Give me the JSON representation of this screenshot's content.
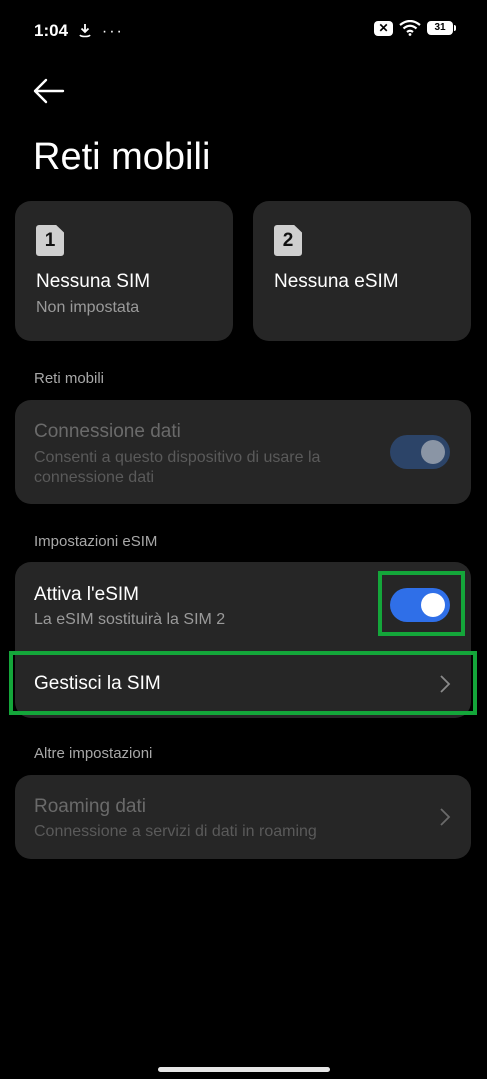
{
  "status_bar": {
    "time": "1:04",
    "left_icons": "⟟ ···",
    "sim_badge": "✕",
    "battery": "31"
  },
  "page": {
    "title": "Reti mobili"
  },
  "sims": [
    {
      "number": "1",
      "title": "Nessuna SIM",
      "subtitle": "Non impostata"
    },
    {
      "number": "2",
      "title": "Nessuna eSIM",
      "subtitle": ""
    }
  ],
  "sections": {
    "mobile_networks": "Reti mobili",
    "esim_settings": "Impostazioni eSIM",
    "other_settings": "Altre impostazioni"
  },
  "data_connection": {
    "title": "Connessione dati",
    "subtitle_line1": "Consenti a questo dispositivo di usare la",
    "subtitle_line2": "connessione dati",
    "toggle_on": true,
    "enabled": false
  },
  "activate_esim": {
    "title": "Attiva l'eSIM",
    "subtitle": "La eSIM sostituirà la SIM 2",
    "toggle_on": true
  },
  "manage_sim": {
    "title": "Gestisci la SIM"
  },
  "roaming": {
    "title": "Roaming dati",
    "subtitle": "Connessione a servizi di dati in roaming",
    "enabled": false
  },
  "colors": {
    "accent": "#2f6fe8",
    "toggle_disabled": "#2c4468",
    "highlight": "#14a63a",
    "card": "#262626"
  }
}
